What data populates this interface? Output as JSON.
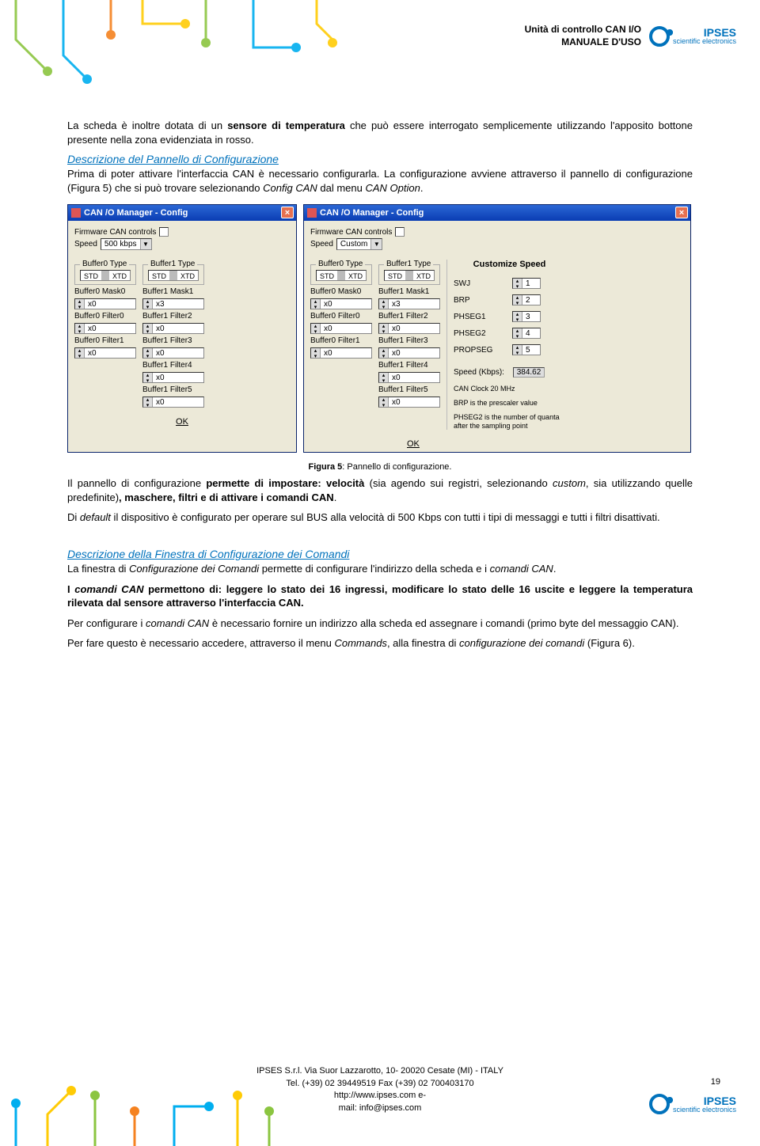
{
  "header": {
    "title_line1": "Unità di controllo CAN I/O",
    "title_line2": "MANUALE D'USO",
    "logo_name": "IPSES",
    "logo_sub": "scientific electronics"
  },
  "body": {
    "p1_a": "La scheda è inoltre dotata di un ",
    "p1_b": "sensore di temperatura",
    "p1_c": " che può essere interrogato semplicemente utilizzando l'apposito bottone presente nella zona evidenziata in rosso.",
    "h1": "Descrizione del Pannello di Configurazione",
    "p2_a": "Prima di poter attivare l'interfaccia CAN è necessario configurarla. La configurazione avviene attraverso il pannello di configurazione (Figura 5) che si può trovare selezionando ",
    "p2_b": "Config CAN",
    "p2_c": " dal menu ",
    "p2_d": "CAN Option",
    "p2_e": ".",
    "caption_a": "Figura 5",
    "caption_b": ": Pannello di configurazione.",
    "p3_a": "Il pannello di configurazione ",
    "p3_b": "permette di impostare: velocità",
    "p3_c": " (sia agendo sui registri, selezionando ",
    "p3_d": "custom",
    "p3_e": ", sia utilizzando quelle predefinite)",
    "p3_f": ", maschere, filtri e di attivare i comandi CAN",
    "p3_g": ".",
    "p4_a": "Di ",
    "p4_b": "default",
    "p4_c": " il dispositivo è configurato per operare sul BUS alla velocità di 500 Kbps con tutti i tipi di messaggi e tutti i filtri disattivati.",
    "h2": "Descrizione della Finestra di Configurazione dei Comandi",
    "p5_a": "La finestra di ",
    "p5_b": "Configurazione dei Comandi",
    "p5_c": " permette di configurare l'indirizzo della scheda e i ",
    "p5_d": "comandi CAN",
    "p5_e": ".",
    "p6_a": "I ",
    "p6_b": "comandi CAN",
    "p6_c": " permettono di: leggere lo stato dei 16 ingressi, modificare lo stato delle 16 uscite e leggere la temperatura rilevata dal sensore attraverso l'interfaccia CAN.",
    "p7_a": "Per configurare i ",
    "p7_b": "comandi CAN",
    "p7_c": " è necessario fornire un indirizzo alla scheda ed assegnare i comandi (primo byte del messaggio CAN).",
    "p8_a": "Per fare questo è necessario accedere, attraverso il menu ",
    "p8_b": "Commands",
    "p8_c": ", alla finestra di ",
    "p8_d": "configurazione dei comandi",
    "p8_e": " (Figura 6)."
  },
  "dialog1": {
    "title": "CAN /O Manager - Config",
    "firmware_label": "Firmware CAN controls",
    "speed_label": "Speed",
    "speed_value": "500 kbps",
    "buf0_type": "Buffer0 Type",
    "buf1_type": "Buffer1 Type",
    "std": "STD",
    "xtd": "XTD",
    "b0_mask0": "Buffer0 Mask0",
    "b1_mask1": "Buffer1 Mask1",
    "b0_filter0": "Buffer0 Filter0",
    "b1_filter2": "Buffer1 Filter2",
    "b0_filter1": "Buffer0 Filter1",
    "b1_filter3": "Buffer1 Filter3",
    "b1_filter4": "Buffer1 Filter4",
    "b1_filter5": "Buffer1 Filter5",
    "x0": "x0",
    "x3": "x3",
    "ok": "OK"
  },
  "dialog2": {
    "title": "CAN /O Manager - Config",
    "speed_value": "Custom",
    "customize_title": "Customize Speed",
    "swj": "SWJ",
    "swj_v": "1",
    "brp": "BRP",
    "brp_v": "2",
    "phseg1": "PHSEG1",
    "phseg1_v": "3",
    "phseg2": "PHSEG2",
    "phseg2_v": "4",
    "propseg": "PROPSEG",
    "propseg_v": "5",
    "speed_kbps_label": "Speed (Kbps):",
    "speed_kbps_v": "384.62",
    "note1": "CAN Clock 20 MHz",
    "note2": "BRP is the prescaler value",
    "note3": "PHSEG2 is the number of quanta after the sampling point"
  },
  "footer": {
    "line1": "IPSES S.r.l.  Via Suor Lazzarotto, 10- 20020 Cesate (MI) - ITALY",
    "line2": "Tel. (+39) 02 39449519   Fax (+39) 02 700403170",
    "line3": "http://www.ipses.com   e-",
    "line4": "mail: info@ipses.com",
    "page": "19"
  }
}
